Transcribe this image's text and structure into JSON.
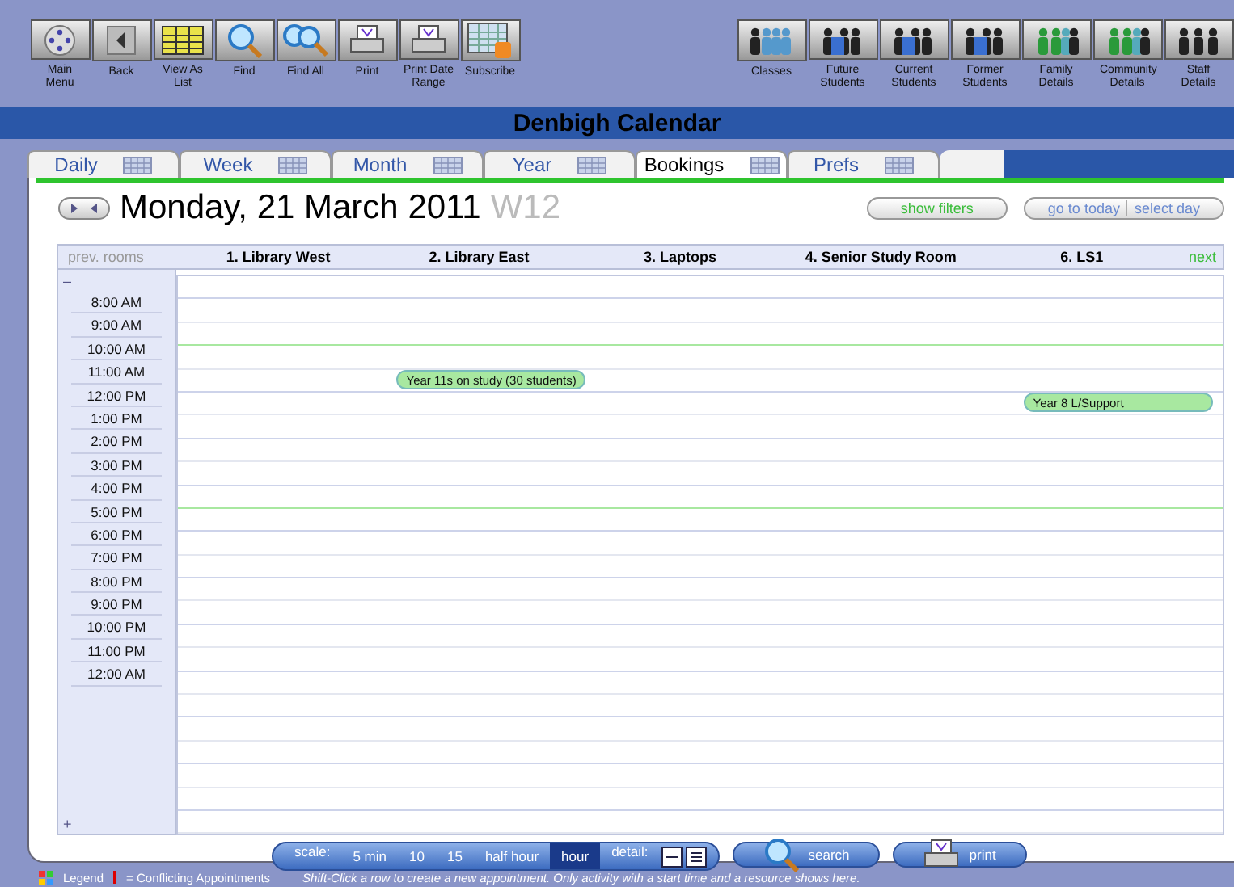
{
  "toolbar_left": [
    {
      "label": "Main Menu",
      "kind": "menu"
    },
    {
      "label": "Back",
      "kind": "back"
    },
    {
      "label": "View As List",
      "kind": "list"
    },
    {
      "label": "Find",
      "kind": "find"
    },
    {
      "label": "Find All",
      "kind": "findall"
    },
    {
      "label": "Print",
      "kind": "print"
    },
    {
      "label": "Print Date Range",
      "kind": "print"
    },
    {
      "label": "Subscribe",
      "kind": "subscribe"
    }
  ],
  "toolbar_right": [
    {
      "label": "Classes",
      "kind": "group"
    },
    {
      "label": "Future Students",
      "kind": "students"
    },
    {
      "label": "Current Students",
      "kind": "students"
    },
    {
      "label": "Former Students",
      "kind": "students"
    },
    {
      "label": "Family Details",
      "kind": "family"
    },
    {
      "label": "Community Details",
      "kind": "family"
    },
    {
      "label": "Staff Details",
      "kind": "staff"
    }
  ],
  "title": "Denbigh Calendar",
  "tabs": [
    {
      "label": "Daily",
      "selected": false
    },
    {
      "label": "Week",
      "selected": false
    },
    {
      "label": "Month",
      "selected": false
    },
    {
      "label": "Year",
      "selected": false
    },
    {
      "label": "Bookings",
      "selected": true
    },
    {
      "label": "Prefs",
      "selected": false
    }
  ],
  "date": "Monday, 21 March 2011",
  "week": "W12",
  "buttons": {
    "filters": "show filters",
    "today": "go to today",
    "select_day": "select day"
  },
  "grid": {
    "prev": "prev. rooms",
    "next": "next",
    "collapse": "–",
    "expand": "+",
    "rooms": [
      "1. Library West",
      "2. Library East",
      "3. Laptops",
      "4. Senior Study Room",
      "6. LS1"
    ],
    "times": [
      {
        "label": "8:00 AM"
      },
      {
        "label": "9:00 AM"
      },
      {
        "label": "10:00 AM"
      },
      {
        "label": "11:00 AM",
        "cells": [
          {
            "booked": false
          },
          {
            "booked": true,
            "label": "Year 11s on study (30 students)"
          },
          {
            "booked": false
          },
          {
            "booked": false
          },
          {
            "booked": false
          }
        ]
      },
      {
        "label": "12:00 PM",
        "cells": [
          {
            "booked": false
          },
          {
            "booked": false
          },
          {
            "booked": false
          },
          {
            "booked": false
          },
          {
            "booked": true,
            "label": "Year 8 L/Support"
          }
        ]
      },
      {
        "label": "1:00 PM"
      },
      {
        "label": "2:00 PM"
      },
      {
        "label": "3:00 PM"
      },
      {
        "label": "4:00 PM"
      },
      {
        "label": "5:00 PM"
      },
      {
        "label": "6:00 PM"
      },
      {
        "label": "7:00 PM"
      },
      {
        "label": "8:00 PM"
      },
      {
        "label": "9:00 PM"
      },
      {
        "label": "10:00 PM"
      },
      {
        "label": "11:00 PM"
      },
      {
        "label": "12:00 AM"
      }
    ]
  },
  "scale": {
    "label": "scale:",
    "options": [
      {
        "label": "5 min",
        "selected": false
      },
      {
        "label": "10",
        "selected": false
      },
      {
        "label": "15",
        "selected": false
      },
      {
        "label": "half hour",
        "selected": false
      },
      {
        "label": "hour",
        "selected": true
      }
    ],
    "detail": "detail:"
  },
  "actions": {
    "search": "search",
    "print": "print"
  },
  "status": {
    "legend": "Legend",
    "conflict": "= Conflicting Appointments",
    "hint": "Shift-Click a row to create a new appointment. Only activity with a start time and a resource shows here."
  }
}
